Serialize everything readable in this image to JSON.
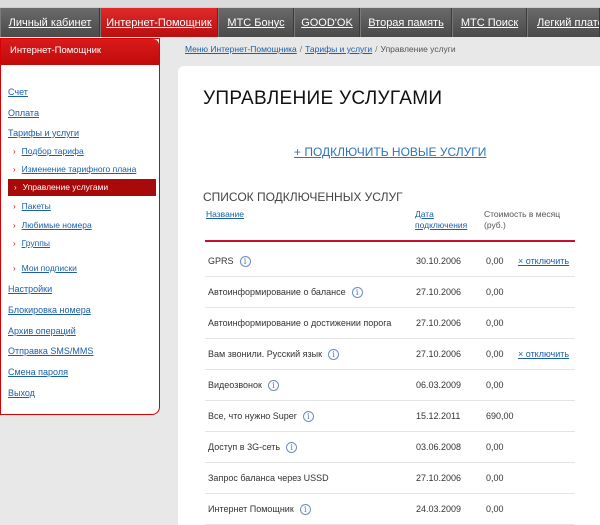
{
  "topnav": {
    "tabs": [
      {
        "label": "Личный кабинет",
        "active": false
      },
      {
        "label": "Интернет-Помощник",
        "active": true
      },
      {
        "label": "МТС Бонус",
        "active": false
      },
      {
        "label": "GOOD'OK",
        "active": false
      },
      {
        "label": "Вторая память",
        "active": false
      },
      {
        "label": "МТС Поиск",
        "active": false
      },
      {
        "label": "Легкий плате",
        "active": false
      }
    ]
  },
  "sidebar": {
    "title": "Интернет-Помощник",
    "items": {
      "schet": "Счет",
      "oplata": "Оплата",
      "tarify": "Тарифы и услуги",
      "podbor": "Подбор тарифа",
      "izmenenie": "Изменение тарифного плана",
      "upravlenie": "Управление услугами",
      "pakety": "Пакеты",
      "lyubimye": "Любимые номера",
      "gruppy": "Группы",
      "podpiski": "Мои подписки",
      "nastroiki": "Настройки",
      "blokirovka": "Блокировка номера",
      "arhiv": "Архив операций",
      "sms": "Отправка SMS/MMS",
      "parol": "Смена пароля",
      "vyhod": "Выход"
    }
  },
  "breadcrumb": {
    "item1": "Меню Интернет-Помощника",
    "item2": "Тарифы и услуги",
    "current": "Управление услуги",
    "separator": "/"
  },
  "main": {
    "title": "УПРАВЛЕНИЕ УСЛУГАМИ",
    "add_link": "+ ПОДКЛЮЧИТЬ НОВЫЕ УСЛУГИ",
    "list_title": "СПИСОК ПОДКЛЮЧЕННЫХ УСЛУГ",
    "columns": {
      "name": "Название",
      "date_line1": "Дата",
      "date_line2": "подключения",
      "cost_line1": "Стоимость в месяц",
      "cost_line2": "(руб.)"
    },
    "info_glyph": "i",
    "rows": [
      {
        "name": "GPRS",
        "date": "30.10.2006",
        "cost": "0,00",
        "action": "× отключить"
      },
      {
        "name": "Автоинформирование о балансе",
        "date": "27.10.2006",
        "cost": "0,00",
        "action": ""
      },
      {
        "name": "Автоинформирование о достижении порога",
        "date": "27.10.2006",
        "cost": "0,00",
        "action": ""
      },
      {
        "name": "Вам звонили. Русский язык",
        "date": "27.10.2006",
        "cost": "0,00",
        "action": "× отключить"
      },
      {
        "name": "Видеозвонок",
        "date": "06.03.2009",
        "cost": "0,00",
        "action": ""
      },
      {
        "name": "Все, что нужно Super",
        "date": "15.12.2011",
        "cost": "690,00",
        "action": ""
      },
      {
        "name": "Доступ в 3G-сеть",
        "date": "03.06.2008",
        "cost": "0,00",
        "action": ""
      },
      {
        "name": "Запрос баланса через USSD",
        "date": "27.10.2006",
        "cost": "0,00",
        "action": ""
      },
      {
        "name": "Интернет Помощник",
        "date": "24.03.2009",
        "cost": "0,00",
        "action": ""
      }
    ]
  },
  "colors": {
    "accent_red": "#c8102e",
    "link_blue": "#1a5fa8",
    "nav_gray": "#5a5a5a"
  }
}
